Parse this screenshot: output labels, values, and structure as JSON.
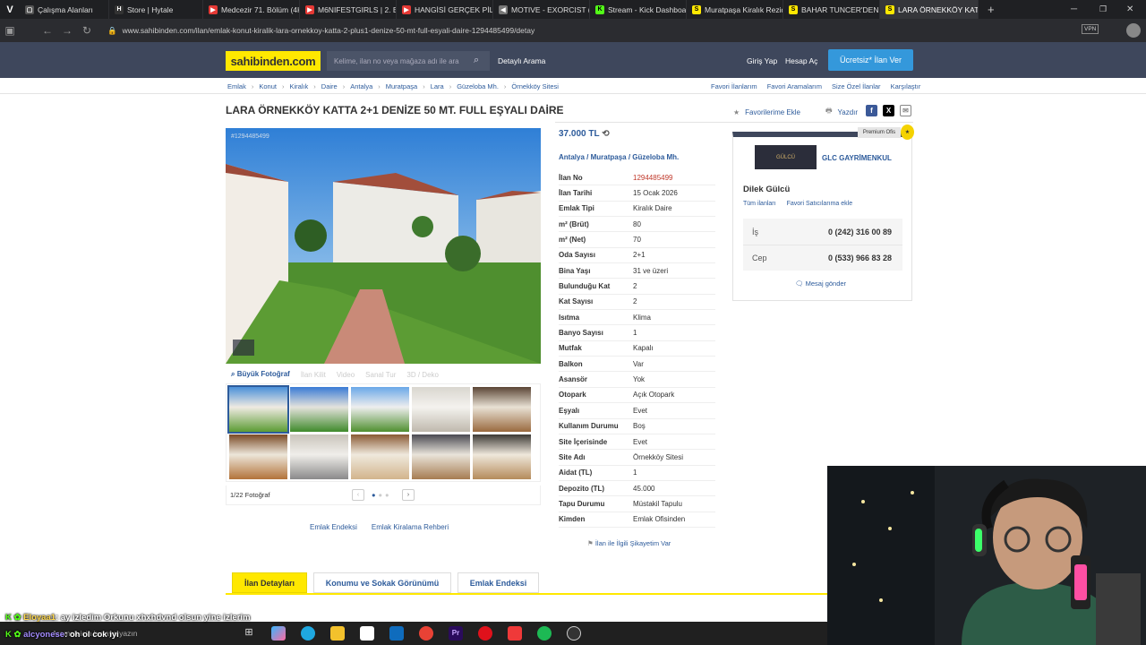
{
  "browser": {
    "tabs": [
      {
        "label": "Çalışma Alanları",
        "color": "#555555",
        "glyph": "▢"
      },
      {
        "label": "Store | Hytale",
        "color": "#333333",
        "glyph": "H"
      },
      {
        "label": "Medcezir 71. Bölüm (4K",
        "color": "#e53935",
        "glyph": "▶"
      },
      {
        "label": "M6NIFESTGIRLS | 2. Böl",
        "color": "#e53935",
        "glyph": "▶"
      },
      {
        "label": "HANGİSİ GERÇEK PİLOT",
        "color": "#e53935",
        "glyph": "▶"
      },
      {
        "label": "MOTIVE - EXORCIST (Of",
        "color": "#777777",
        "glyph": "◀"
      },
      {
        "label": "Stream - Kick Dashboar",
        "color": "#53fc18",
        "glyph": "K"
      },
      {
        "label": "Muratpaşa Kiralık Rezid",
        "color": "#ffe800",
        "glyph": "S"
      },
      {
        "label": "BAHAR TUNCER'DEN G",
        "color": "#ffe800",
        "glyph": "S"
      },
      {
        "label": "LARA ÖRNEKKÖY KATTA",
        "color": "#ffe800",
        "glyph": "S"
      }
    ],
    "url": "www.sahibinden.com/ilan/emlak-konut-kiralik-lara-ornekkoy-katta-2-plus1-denize-50-mt-full-esyali-daire-1294485499/detay"
  },
  "site": {
    "logo": "sahibinden.com",
    "search_placeholder": "Kelime, ilan no veya mağaza adı ile ara",
    "detailed_search": "Detaylı Arama",
    "login": "Giriş Yap",
    "register": "Hesap Aç",
    "post_ad": "Ücretsiz* İlan Ver"
  },
  "breadcrumb": [
    "Emlak",
    "Konut",
    "Kiralık",
    "Daire",
    "Antalya",
    "Muratpaşa",
    "Lara",
    "Güzeloba Mh.",
    "Örnekköy Sitesi"
  ],
  "right_links": [
    "Favori İlanlarım",
    "Favori Aramalarım",
    "Size Özel İlanlar",
    "Karşılaştır"
  ],
  "listing": {
    "title": "LARA ÖRNEKKÖY KATTA 2+1 DENİZE 50 MT. FULL EŞYALI DAİRE",
    "favorite": "Favorilerime Ekle",
    "print": "Yazdır",
    "photo_watermark": "#1294485499",
    "photo_tools": [
      "Büyük Fotoğraf",
      "İlan Kilit",
      "Video",
      "Sanal Tur",
      "3D / Deko"
    ],
    "photo_counter": "1/22 Fotoğraf",
    "below_links": [
      "Emlak Endeksi",
      "Emlak Kiralama Rehberi"
    ],
    "price": "37.000 TL",
    "location": [
      "Antalya",
      "Muratpaşa",
      "Güzeloba Mh."
    ],
    "details": [
      {
        "k": "İlan No",
        "v": "1294485499",
        "red": true
      },
      {
        "k": "İlan Tarihi",
        "v": "15 Ocak 2026"
      },
      {
        "k": "Emlak Tipi",
        "v": "Kiralık Daire"
      },
      {
        "k": "m² (Brüt)",
        "v": "80"
      },
      {
        "k": "m² (Net)",
        "v": "70"
      },
      {
        "k": "Oda Sayısı",
        "v": "2+1"
      },
      {
        "k": "Bina Yaşı",
        "v": "31 ve üzeri"
      },
      {
        "k": "Bulunduğu Kat",
        "v": "2"
      },
      {
        "k": "Kat Sayısı",
        "v": "2"
      },
      {
        "k": "Isıtma",
        "v": "Klima"
      },
      {
        "k": "Banyo Sayısı",
        "v": "1"
      },
      {
        "k": "Mutfak",
        "v": "Kapalı"
      },
      {
        "k": "Balkon",
        "v": "Var"
      },
      {
        "k": "Asansör",
        "v": "Yok"
      },
      {
        "k": "Otopark",
        "v": "Açık Otopark"
      },
      {
        "k": "Eşyalı",
        "v": "Evet"
      },
      {
        "k": "Kullanım Durumu",
        "v": "Boş"
      },
      {
        "k": "Site İçerisinde",
        "v": "Evet"
      },
      {
        "k": "Site Adı",
        "v": "Örnekköy Sitesi"
      },
      {
        "k": "Aidat (TL)",
        "v": "1"
      },
      {
        "k": "Depozito (TL)",
        "v": "45.000"
      },
      {
        "k": "Tapu Durumu",
        "v": "Müstakil Tapulu"
      },
      {
        "k": "Kimden",
        "v": "Emlak Ofisinden"
      }
    ],
    "complain": "İlan ile İlgili Şikayetim Var"
  },
  "seller": {
    "badge": "Premium Ofis",
    "logo_text": "GÜLCÜ",
    "name": "GLC GAYRİMENKUL",
    "agent": "Dilek Gülcü",
    "all_ads": "Tüm ilanları",
    "add_fav": "Favori Satıcılarıma ekle",
    "phones": [
      {
        "k": "İş",
        "v": "0 (242) 316 00 89"
      },
      {
        "k": "Cep",
        "v": "0 (533) 966 83 28"
      }
    ],
    "message": "Mesaj gönder"
  },
  "bottom_tabs": [
    "İlan Detayları",
    "Konumu ve Sokak Görünümü",
    "Emlak Endeksi"
  ],
  "chat": [
    {
      "user": "Eloyaa1",
      "text": ": ay izledim Orkunu xhxhdvnd olsun yine izlerim"
    },
    {
      "user": "alcyonese",
      "text": ": oh ol cok iyi"
    }
  ],
  "taskbar_search": "Aramak için buraya yazın",
  "colors": {
    "brand_yellow": "#ffe800",
    "header": "#3e475c",
    "link": "#2d5b9b",
    "ad_no": "#c0392b"
  }
}
